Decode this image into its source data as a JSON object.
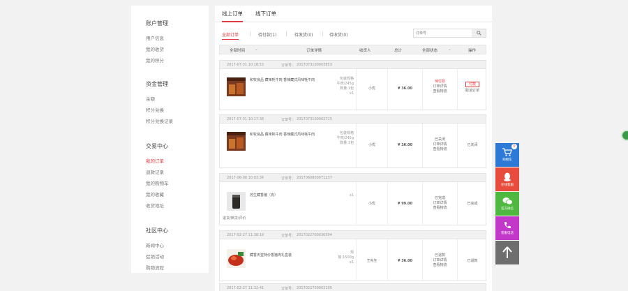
{
  "sidebar": {
    "groups": [
      {
        "title": "账户管理",
        "items": [
          "用户信息",
          "我的收货",
          "我的积分"
        ]
      },
      {
        "title": "资金管理",
        "items": [
          "余额",
          "积分兑换",
          "积分兑换记录"
        ]
      },
      {
        "title": "交易中心",
        "items": [
          "我的订单",
          "退款记录",
          "我的购物车",
          "我的收藏",
          "收货地址"
        ]
      },
      {
        "title": "社区中心",
        "items": [
          "新闻中心",
          "促销活动",
          "购物流程"
        ]
      }
    ],
    "active_item": "我的订单"
  },
  "tabs": [
    "线上订单",
    "线下订单"
  ],
  "filters": [
    "全部订单",
    "待付款(1)",
    "待发货(0)",
    "待收货(0)"
  ],
  "search": {
    "placeholder": "订单号"
  },
  "table_head": {
    "time": "全部时间",
    "detail": "订单详情",
    "receiver": "收货人",
    "total": "总计",
    "status": "全部状态",
    "action": "操作"
  },
  "orders": [
    {
      "date": "2017-07-31 10:18:53",
      "order_no_label": "订单号：",
      "order_no": "2017073100003853",
      "product": "和牧良品 藏味牦牛肉 香辣藏式风味牦牛肉",
      "spec": [
        "包装规格",
        "牛肉/245g",
        "数量:1包",
        "x1"
      ],
      "receiver": "小优",
      "price": "¥ 36.00",
      "status": [
        "待付款",
        "订单详情",
        "查看物流"
      ],
      "action": [
        "付款",
        "取消订单"
      ]
    },
    {
      "date": "2017-07-31 10:17:38",
      "order_no_label": "订单号：",
      "order_no": "2017073100002715",
      "product": "和牧良品 藏味牦牛肉 香辣藏式风味牦牛肉",
      "spec": [
        "包装规格",
        "牛肉/245g",
        "数量:1包",
        "x1"
      ],
      "receiver": "小优",
      "price": "¥ 36.00",
      "status": [
        "已关闭",
        "订单详情",
        "查看物流"
      ],
      "action": [
        "已关闭"
      ]
    },
    {
      "date": "2017-06-08 10:03:34",
      "order_no_label": "订单号：",
      "order_no": "2017060800071237",
      "product": "苏生藏香猪（克）",
      "extra": "退货/换货/评价",
      "spec": [
        "x1"
      ],
      "receiver": "小优",
      "price": "¥ 99.00",
      "status": [
        "已完成",
        "订单详情",
        "查看物流"
      ],
      "action": [
        "已完成"
      ]
    },
    {
      "date": "2017-02-27 11:38:19",
      "order_no_label": "订单号：",
      "order_no": "2017022700030594",
      "product": "藏香天堂特价香猪肉礼盒装",
      "spec": [
        "规",
        "格:1500g",
        "x1"
      ],
      "receiver": "王先生",
      "price": "¥ 36.00",
      "status": [
        "已退款",
        "订单详情",
        "查看物流"
      ],
      "action": [
        "已退款"
      ]
    },
    {
      "date": "2017-02-27 11:32:41",
      "order_no_label": "订单号：",
      "order_no": "2017022700002105"
    }
  ],
  "float_bar": [
    {
      "label": "购物车",
      "icon": "cart-icon",
      "color": "#2d7ad6",
      "badge": "0"
    },
    {
      "label": "在线客服",
      "icon": "qq-icon",
      "color": "#e84c3d"
    },
    {
      "label": "官方微信",
      "icon": "wechat-icon",
      "color": "#4fb840"
    },
    {
      "label": "客服电话",
      "icon": "phone-icon",
      "color": "#c238c8"
    },
    {
      "label": "",
      "icon": "arrow-up-icon",
      "color": "#6e6e6e"
    }
  ]
}
